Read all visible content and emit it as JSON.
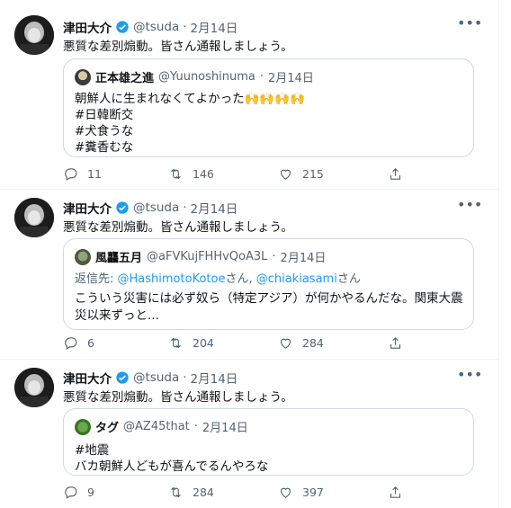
{
  "tweets": [
    {
      "name": "津田大介",
      "handle": "@tsuda",
      "dot": "·",
      "date": "2月14日",
      "text": "悪質な差別煽動。皆さん通報しましょう。",
      "quote": {
        "name": "正本雄之進",
        "handle": "@Yuunoshinuma",
        "dot": "·",
        "date": "2月14日",
        "lines": [
          "朝鮮人に生まれなくてよかった🙌🙌🙌🙌",
          "#日韓断交",
          "#犬食うな",
          "#糞香むな"
        ]
      },
      "replies": "11",
      "retweets": "146",
      "likes": "215"
    },
    {
      "name": "津田大介",
      "handle": "@tsuda",
      "dot": "·",
      "date": "2月14日",
      "text": "悪質な差別煽動。皆さん通報しましょう。",
      "quote": {
        "name": "風龘五月",
        "handle": "@aFVKujFHHvQoA3L",
        "dot": "·",
        "date": "2月14日",
        "reply_label": "返信先:",
        "reply_mention_1": "@HashimotoKotoe",
        "reply_san_1": "さん,",
        "reply_mention_2": "@chiakiasami",
        "reply_san_2": "さん",
        "lines": [
          "こういう災害には必ず奴ら（特定アジア）が何かやるんだな。関東大震",
          "災以来ずっと..."
        ]
      },
      "replies": "6",
      "retweets": "204",
      "likes": "284"
    },
    {
      "name": "津田大介",
      "handle": "@tsuda",
      "dot": "·",
      "date": "2月14日",
      "text": "悪質な差別煽動。皆さん通報しましょう。",
      "quote": {
        "name": "タグ",
        "handle": "@AZ45that",
        "dot": "·",
        "date": "2月14日",
        "lines": [
          "#地震",
          "バカ朝鮮人どもが喜んでるんやろな"
        ]
      },
      "replies": "9",
      "retweets": "284",
      "likes": "397"
    }
  ],
  "icons": {
    "more": "more-icon",
    "verified": "verified-badge-icon",
    "reply": "reply-icon",
    "retweet": "retweet-icon",
    "like": "like-icon",
    "share": "share-icon"
  },
  "colors": {
    "accent": "#1d9bf0",
    "secondary_text": "#536471",
    "border": "#cfd9de"
  }
}
